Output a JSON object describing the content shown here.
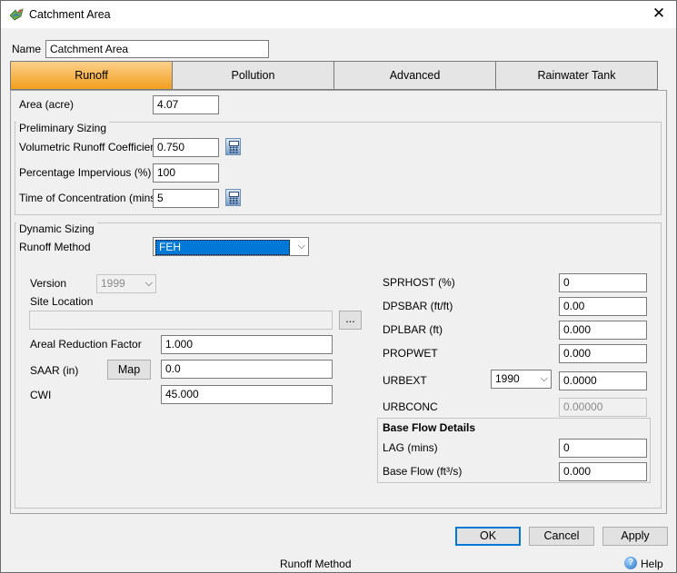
{
  "window": {
    "title": "Catchment Area"
  },
  "name_field": {
    "label": "Name",
    "value": "Catchment Area"
  },
  "tabs": [
    {
      "label": "Runoff",
      "active": true
    },
    {
      "label": "Pollution",
      "active": false
    },
    {
      "label": "Advanced",
      "active": false
    },
    {
      "label": "Rainwater Tank",
      "active": false
    }
  ],
  "runoff": {
    "area": {
      "label": "Area (acre)",
      "value": "4.07"
    },
    "preliminary_sizing": {
      "legend": "Preliminary Sizing",
      "volumetric_runoff_coefficient": {
        "label": "Volumetric Runoff Coefficient",
        "value": "0.750"
      },
      "percentage_impervious": {
        "label": "Percentage Impervious (%)",
        "value": "100"
      },
      "time_of_concentration": {
        "label": "Time of Concentration (mins)",
        "value": "5"
      }
    },
    "dynamic_sizing": {
      "legend": "Dynamic Sizing",
      "runoff_method": {
        "label": "Runoff Method",
        "value": "FEH"
      },
      "version": {
        "label": "Version",
        "value": "1999"
      },
      "site_location": {
        "label": "Site Location",
        "value": "",
        "browse_label": "..."
      },
      "areal_reduction_factor": {
        "label": "Areal Reduction Factor",
        "value": "1.000"
      },
      "saar": {
        "label": "SAAR (in)",
        "map_button": "Map",
        "value": "0.0"
      },
      "cwi": {
        "label": "CWI",
        "value": "45.000"
      },
      "sprhost": {
        "label": "SPRHOST (%)",
        "value": "0"
      },
      "dpsbar": {
        "label": "DPSBAR (ft/ft)",
        "value": "0.00"
      },
      "dplbar": {
        "label": "DPLBAR (ft)",
        "value": "0.000"
      },
      "propwet": {
        "label": "PROPWET",
        "value": "0.000"
      },
      "urbext": {
        "label": "URBEXT",
        "year": "1990",
        "value": "0.0000"
      },
      "urbconc": {
        "label": "URBCONC",
        "value": "0.00000"
      },
      "base_flow": {
        "legend": "Base Flow Details",
        "lag": {
          "label": "LAG (mins)",
          "value": "0"
        },
        "base_flow": {
          "label": "Base Flow (ft³/s)",
          "value": "0.000"
        }
      }
    }
  },
  "buttons": {
    "ok": "OK",
    "cancel": "Cancel",
    "apply": "Apply"
  },
  "status_bar": {
    "text": "Runoff Method",
    "help": "Help"
  }
}
